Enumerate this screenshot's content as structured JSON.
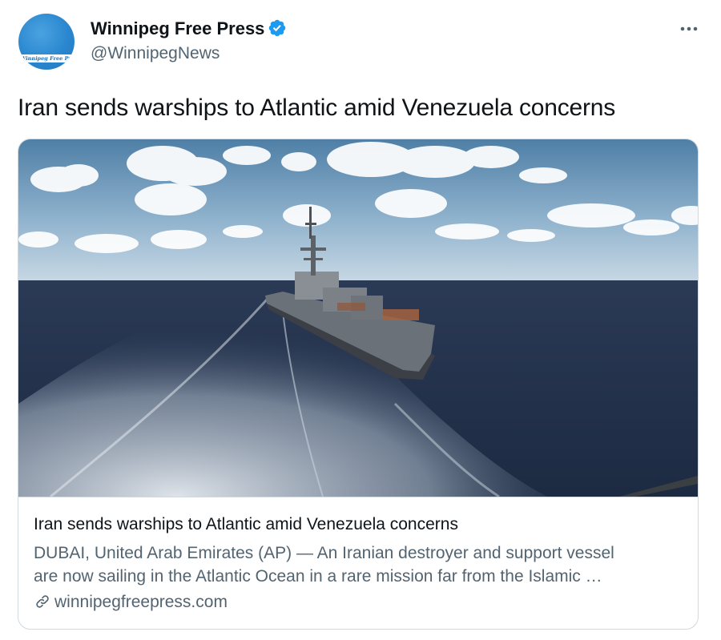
{
  "author": {
    "avatar_text": "Winnipeg Free Press",
    "display_name": "Winnipeg Free Press",
    "handle": "@WinnipegNews",
    "verified": true
  },
  "tweet": {
    "text": "Iran sends warships to Atlantic amid Venezuela concerns"
  },
  "card": {
    "image_icon": "warship-photo",
    "title": "Iran sends warships to Atlantic amid Venezuela concerns",
    "description_line1": "DUBAI, United Arab Emirates (AP) — An Iranian destroyer and support vessel",
    "description_line2": "are now sailing in the Atlantic Ocean in a rare mission far from the Islamic …",
    "domain": "winnipegfreepress.com"
  },
  "icons": {
    "verified": "verified-badge-icon",
    "more": "more-dots-icon",
    "link": "link-icon"
  },
  "colors": {
    "text_primary": "#0f1419",
    "text_secondary": "#536471",
    "verified_blue": "#1d9bf0",
    "card_border": "#cfd9de",
    "avatar_blue": "#2a87cf"
  }
}
